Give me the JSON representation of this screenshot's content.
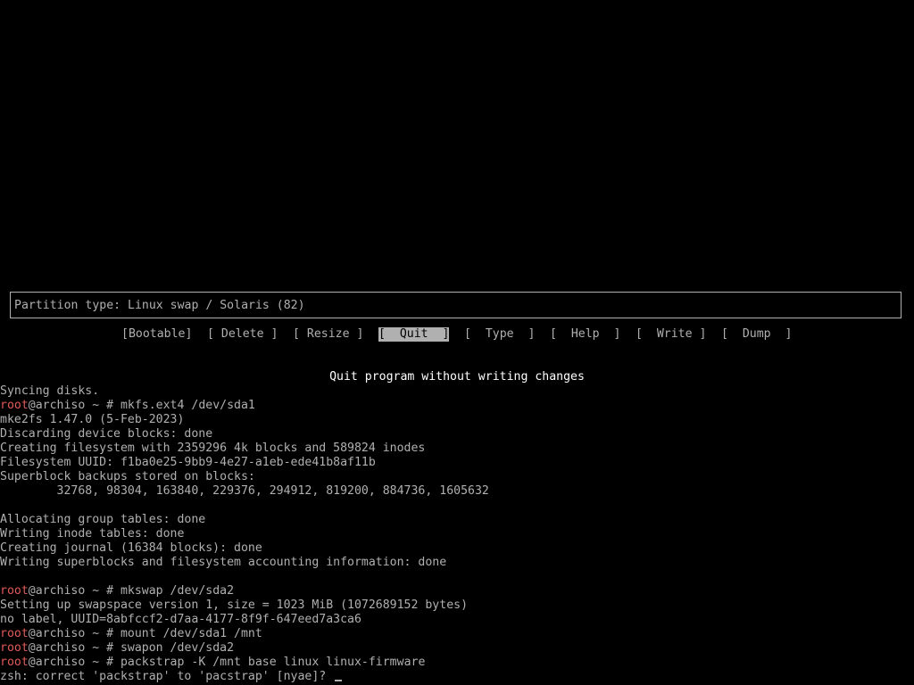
{
  "cfdisk": {
    "info": "Partition type: Linux swap / Solaris (82)",
    "menu": [
      {
        "label": "[Bootable]"
      },
      {
        "label": "[ Delete ]"
      },
      {
        "label": "[ Resize ]"
      },
      {
        "label": "[  Quit  ]",
        "selected": true
      },
      {
        "label": "[  Type  ]"
      },
      {
        "label": "[  Help  ]"
      },
      {
        "label": "[  Write ]"
      },
      {
        "label": "[  Dump  ]"
      }
    ],
    "status": "Quit program without writing changes"
  },
  "terminal": {
    "prompt_user": "root",
    "prompt_rest": "@archiso ~ # ",
    "lines": [
      {
        "text": "Syncing disks."
      },
      {
        "cmd": "mkfs.ext4 /dev/sda1"
      },
      {
        "text": "mke2fs 1.47.0 (5-Feb-2023)"
      },
      {
        "text": "Discarding device blocks: done"
      },
      {
        "text": "Creating filesystem with 2359296 4k blocks and 589824 inodes"
      },
      {
        "text": "Filesystem UUID: f1ba0e25-9bb9-4e27-a1eb-ede41b8af11b"
      },
      {
        "text": "Superblock backups stored on blocks:"
      },
      {
        "text": "        32768, 98304, 163840, 229376, 294912, 819200, 884736, 1605632"
      },
      {
        "text": ""
      },
      {
        "text": "Allocating group tables: done"
      },
      {
        "text": "Writing inode tables: done"
      },
      {
        "text": "Creating journal (16384 blocks): done"
      },
      {
        "text": "Writing superblocks and filesystem accounting information: done"
      },
      {
        "text": ""
      },
      {
        "cmd": "mkswap /dev/sda2"
      },
      {
        "text": "Setting up swapspace version 1, size = 1023 MiB (1072689152 bytes)"
      },
      {
        "text": "no label, UUID=8abfccf2-d7aa-4177-8f9f-647eed7a3ca6"
      },
      {
        "cmd": "mount /dev/sda1 /mnt"
      },
      {
        "cmd": "swapon /dev/sda2"
      },
      {
        "cmd": "packstrap -K /mnt base linux linux-firmware"
      },
      {
        "text": "zsh: correct 'packstrap' to 'pacstrap' [nyae]? ",
        "cursor": true
      }
    ]
  },
  "colors": {
    "background": "#000000",
    "foreground": "#b0b0b0",
    "prompt_user": "#e05a5a",
    "status": "#ffffff"
  }
}
